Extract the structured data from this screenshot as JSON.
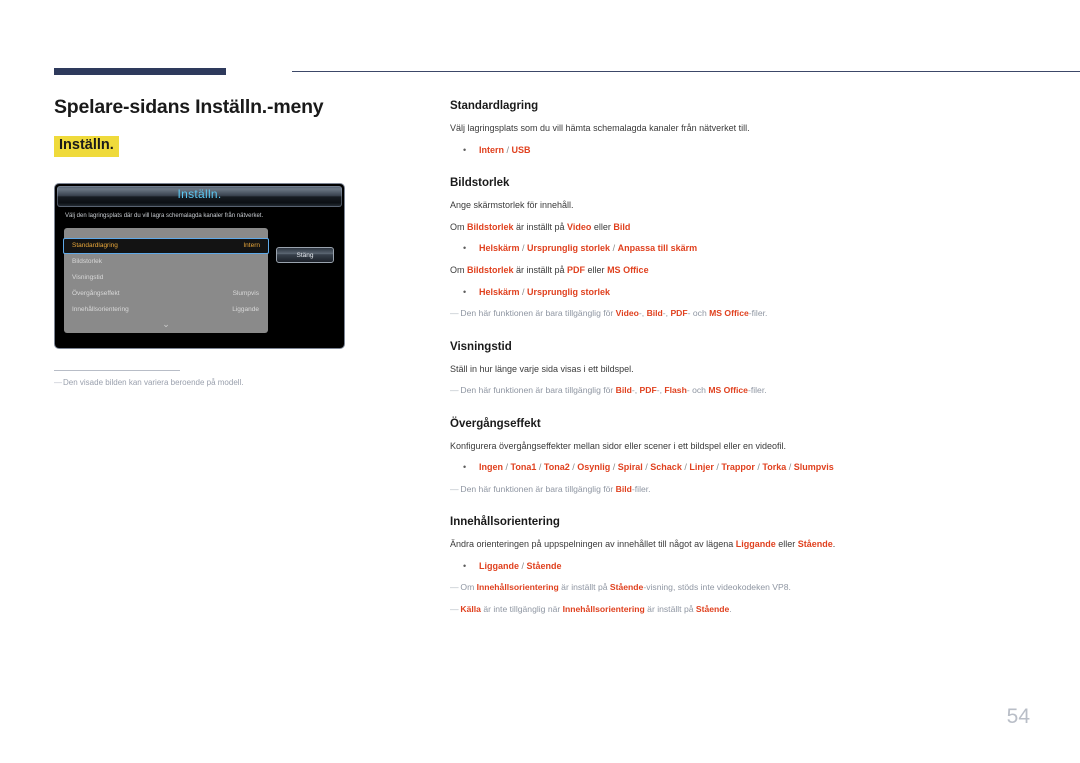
{
  "page": {
    "title": "Spelare-sidans Inställn.-meny",
    "highlight_label": "Inställn.",
    "page_number": "54",
    "accent_red": "#e0411f",
    "highlight_yellow": "#efda3b",
    "header_navy": "#2e3a5c"
  },
  "tv_mock": {
    "title": "Inställn.",
    "description": "Välj den lagringsplats där du vill lagra schemalagda kanaler från nätverket.",
    "rows": [
      {
        "label": "Standardlagring",
        "value": "Intern",
        "selected": true
      },
      {
        "label": "Bildstorlek",
        "value": "",
        "selected": false
      },
      {
        "label": "Visningstid",
        "value": "",
        "selected": false
      },
      {
        "label": "Övergångseffekt",
        "value": "Slumpvis",
        "selected": false
      },
      {
        "label": "Innehållsorientering",
        "value": "Liggande",
        "selected": false
      }
    ],
    "scroll_icon": "chevron-down-icon",
    "close_button": "Stäng",
    "footnote_lead": "―",
    "footnote": "Den visade bilden kan variera beroende på modell."
  },
  "sections": [
    {
      "id": "standardlagring",
      "title": "Standardlagring",
      "body": "Välj lagringsplats som du vill hämta schemalagda kanaler från nätverket till.",
      "bullet_options": [
        "Intern",
        "USB"
      ]
    },
    {
      "id": "bildstorlek",
      "title": "Bildstorlek",
      "body": "Ange skärmstorlek för innehåll.",
      "cond1_pre": "Om ",
      "cond1_a": "Bildstorlek",
      "cond1_mid": " är inställt på ",
      "cond1_b": "Video",
      "cond1_or": " eller ",
      "cond1_c": "Bild",
      "bullet_options_1": [
        "Helskärm",
        "Ursprunglig storlek",
        "Anpassa till skärm"
      ],
      "cond2_pre": "Om ",
      "cond2_a": "Bildstorlek",
      "cond2_mid": " är inställt på ",
      "cond2_b": "PDF",
      "cond2_or": " eller ",
      "cond2_c": "MS Office",
      "bullet_options_2": [
        "Helskärm",
        "Ursprunglig storlek"
      ],
      "note_lead": "―",
      "note_pre": "Den här funktionen är bara tillgänglig för ",
      "note_t1": "Video",
      "note_s1": "-, ",
      "note_t2": "Bild",
      "note_s2": "-, ",
      "note_t3": "PDF",
      "note_s3": "- och ",
      "note_t4": "MS Office",
      "note_end": "-filer."
    },
    {
      "id": "visningstid",
      "title": "Visningstid",
      "body": "Ställ in hur länge varje sida visas i ett bildspel.",
      "note_lead": "―",
      "note_pre": "Den här funktionen är bara tillgänglig för ",
      "note_t1": "Bild",
      "note_s1": "-, ",
      "note_t2": "PDF",
      "note_s2": "-, ",
      "note_t3": "Flash",
      "note_s3": "- och ",
      "note_t4": "MS Office",
      "note_end": "-filer."
    },
    {
      "id": "overgangseffekt",
      "title": "Övergångseffekt",
      "body": "Konfigurera övergångseffekter mellan sidor eller scener i ett bildspel eller en videofil.",
      "bullet_options": [
        "Ingen",
        "Tona1",
        "Tona2",
        "Osynlig",
        "Spiral",
        "Schack",
        "Linjer",
        "Trappor",
        "Torka",
        "Slumpvis"
      ],
      "note_lead": "―",
      "note_pre": "Den här funktionen är bara tillgänglig för ",
      "note_t1": "Bild",
      "note_end": "-filer."
    },
    {
      "id": "innehallsorientering",
      "title": "Innehållsorientering",
      "body_pre": "Ändra orienteringen på uppspelningen av innehållet till något av lägena ",
      "body_t1": "Liggande",
      "body_mid": " eller ",
      "body_t2": "Stående",
      "body_end": ".",
      "bullet_options": [
        "Liggande",
        "Stående"
      ],
      "note1_lead": "―",
      "note1_pre": "Om ",
      "note1_t1": "Innehållsorientering",
      "note1_mid": " är inställt på ",
      "note1_t2": "Stående",
      "note1_end": "-visning, stöds inte videokodeken VP8.",
      "note2_lead": "―",
      "note2_t1": "Källa",
      "note2_pre": " är inte tillgänglig när ",
      "note2_t2": "Innehållsorientering",
      "note2_mid": " är inställt på ",
      "note2_t3": "Stående",
      "note2_end": "."
    }
  ]
}
